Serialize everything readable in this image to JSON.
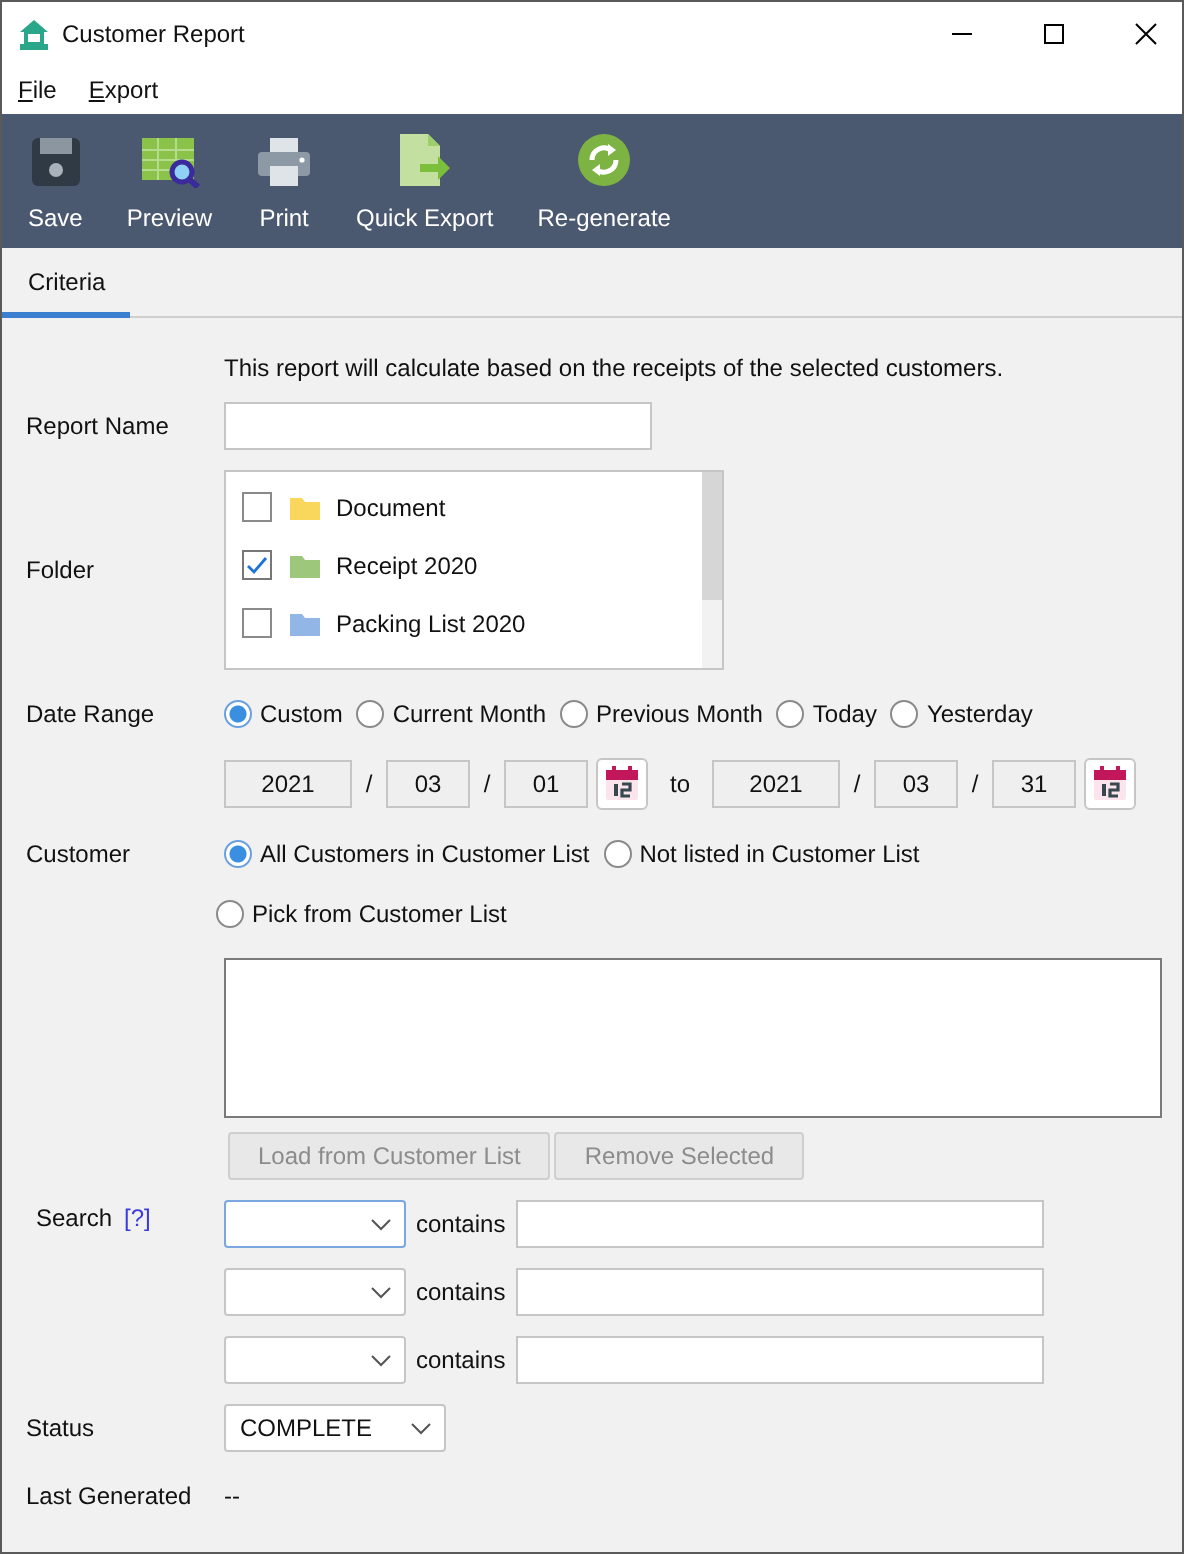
{
  "window": {
    "title": "Customer Report"
  },
  "menu": [
    {
      "label": "File"
    },
    {
      "label": "Export"
    }
  ],
  "toolbar": [
    {
      "label": "Save",
      "kind": "save"
    },
    {
      "label": "Preview",
      "kind": "preview"
    },
    {
      "label": "Print",
      "kind": "print"
    },
    {
      "label": "Quick Export",
      "kind": "export"
    },
    {
      "label": "Re-generate",
      "kind": "regenerate"
    }
  ],
  "tabs": [
    {
      "label": "Criteria",
      "selected": true
    }
  ],
  "intro": "This report will calculate based on the receipts of the selected customers.",
  "report_name": {
    "label": "Report Name"
  },
  "folder": {
    "label": "Folder",
    "items": [
      {
        "name": "Document",
        "checked": false,
        "color": "#f9d65c"
      },
      {
        "name": "Receipt 2020",
        "checked": true,
        "color": "#9dc77a"
      },
      {
        "name": "Packing List 2020",
        "checked": false,
        "color": "#92b6e6"
      }
    ]
  },
  "date_range": {
    "label": "Date Range",
    "options": [
      {
        "label": "Custom",
        "selected": true
      },
      {
        "label": "Current Month",
        "selected": false
      },
      {
        "label": "Previous Month",
        "selected": false
      },
      {
        "label": "Today",
        "selected": false
      },
      {
        "label": "Yesterday",
        "selected": false
      }
    ],
    "from": {
      "parts": [
        "2021",
        "03",
        "01"
      ],
      "separators": [
        "/",
        "/"
      ]
    },
    "to_label": "to",
    "to": {
      "parts": [
        "2021",
        "03",
        "31"
      ],
      "separators": [
        "/",
        "/"
      ]
    }
  },
  "customer": {
    "label": "Customer",
    "options": [
      {
        "label": "All Customers in Customer List",
        "selected": true
      },
      {
        "label": "Not listed in Customer List",
        "selected": false
      },
      {
        "label": "Pick from Customer List",
        "selected": false
      }
    ],
    "buttons": [
      {
        "label": "Load from Customer List",
        "disabled": true
      },
      {
        "label": "Remove Selected",
        "disabled": true
      }
    ]
  },
  "search": {
    "label": "Search",
    "help": "[?]",
    "rows": [
      {
        "operator": "contains",
        "focused": true
      },
      {
        "operator": "contains",
        "focused": false
      },
      {
        "operator": "contains",
        "focused": false
      }
    ]
  },
  "status": {
    "label": "Status",
    "value": "COMPLETE"
  },
  "last_generated": {
    "label": "Last Generated",
    "value": "--"
  }
}
